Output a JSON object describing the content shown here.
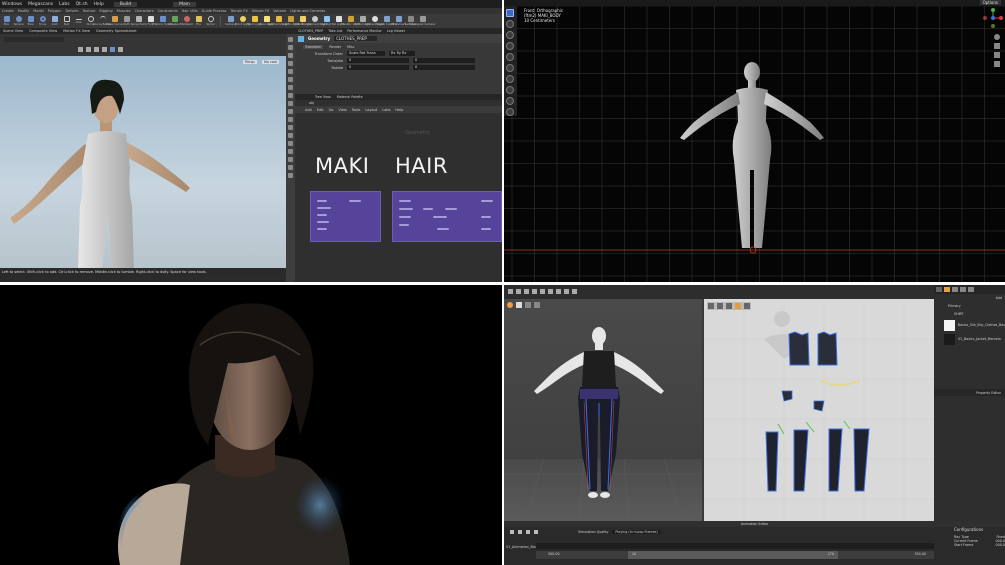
{
  "houdini": {
    "menubar": [
      "Windows",
      "Megascans",
      "Labs",
      "Qt.sh",
      "Help",
      "Build",
      "Main"
    ],
    "shelf_tabs": [
      "Create",
      "Modify",
      "Model",
      "Polygon",
      "Deform",
      "Texture",
      "Rigging",
      "Muscles",
      "Characters",
      "Constraints",
      "Hair Utils",
      "Guide Process",
      "Terrain FX",
      "Simple FX",
      "Volume",
      "Lights and Cameras",
      "Collisions",
      "Particles",
      "Grains",
      "Vellum",
      "Rigid Bodies",
      "Particle Fluids",
      "Viscous Fluids",
      "Oceans",
      "Pyro FX",
      "FEM",
      "Wires",
      "Crowds",
      "Drive Simulation"
    ],
    "tools": [
      "Box",
      "Sphere",
      "Tube",
      "Torus",
      "Grid",
      "Null",
      "Line",
      "Circle",
      "Curve Bezier",
      "Draw Curve",
      "Path",
      "Spray Paint",
      "Font",
      "Platonic Solids",
      "L-System",
      "Metaball",
      "File",
      "Spiral",
      "Camera",
      "Point Light",
      "Spot Light",
      "Area Light",
      "Geometry Light",
      "Volume Light",
      "Distant Light",
      "Environment Light",
      "Sky Light",
      "GI Light",
      "Caustic Light",
      "Portal Light",
      "Ambient Light",
      "Stereo Camera",
      "VR Camera",
      "Switcher",
      "Gamepad Camera"
    ],
    "pane_tabs": [
      "Scene View",
      "Composite View",
      "Motion FX View",
      "Geometry Spreadsheet"
    ],
    "viewport_labels": [
      "Persp",
      "No cam"
    ],
    "status_text": "Left to select. Shift-click to add. Ctrl-click to remove. Middle-click to tumble. Right-click to dolly. Space for view tools.",
    "params": {
      "tabs": [
        "CLOTHES_PREP",
        "Take List",
        "Performance Monitor",
        "Log Viewer"
      ],
      "node_type": "Geometry",
      "node_name": "CLOTHES_PREP",
      "sub_tabs": [
        "Transform",
        "Render",
        "Misc"
      ],
      "rows": [
        {
          "label": "Transform Order",
          "value": "Scale Rot Trans",
          "value2": "Rx Ry Rz"
        },
        {
          "label": "Translate",
          "value": "0",
          "value2": "0"
        },
        {
          "label": "Rotate",
          "value": "0",
          "value2": "0"
        }
      ]
    },
    "network": {
      "path": "obj",
      "tabs": [
        "Tree View",
        "Material Palette"
      ],
      "menu": [
        "Add",
        "Edit",
        "Go",
        "View",
        "Tools",
        "Layout",
        "Labs",
        "Help"
      ],
      "context_label": "Geometry",
      "labels": [
        "MAKI",
        "HAIR"
      ]
    }
  },
  "ortho": {
    "view_name": "Front: Orthographic",
    "object_name": "(ftm2) MAKI_BODY",
    "units": "10 Centimeters",
    "top_right": "Options"
  },
  "marvelous": {
    "animation_editor_title": "Animation Editor",
    "timeline": {
      "simulation_quality": "Simulation Quality",
      "playback_mode": "Playing (In→Loop Frames)",
      "track_name": "V1_Animation_Bla",
      "start_value": "500.00",
      "mid_value": "20",
      "end_value": "270",
      "end_time": "350.00"
    },
    "sidebar": {
      "add_label": "Add",
      "primary_label": "Primary",
      "shirt_label": "SHIRT",
      "fabrics": [
        "Basics_Silk_Slip_Clothes_Bas",
        "V1_Basics_Jacket_Marvelo"
      ],
      "property_editor": "Property Editor",
      "configurations_title": "Configurations",
      "config_rows": [
        {
          "label": "Ray Type",
          "value": "Fixed"
        },
        {
          "label": "Current Frame",
          "value": "000.0"
        },
        {
          "label": "Start Frame",
          "value": "000.0"
        }
      ]
    }
  },
  "colors": {
    "houdini_bg": "#2b2b2b",
    "network_box": "#56449a",
    "viewport_sky": "#b7cad8",
    "ortho_grid": "#3a3a3a",
    "ortho_axis": "#c0392b",
    "marvelous_2d_bg": "#d9d9d9",
    "piping_blue": "#3d6fe0",
    "stitch_yellow": "#e8d860"
  }
}
